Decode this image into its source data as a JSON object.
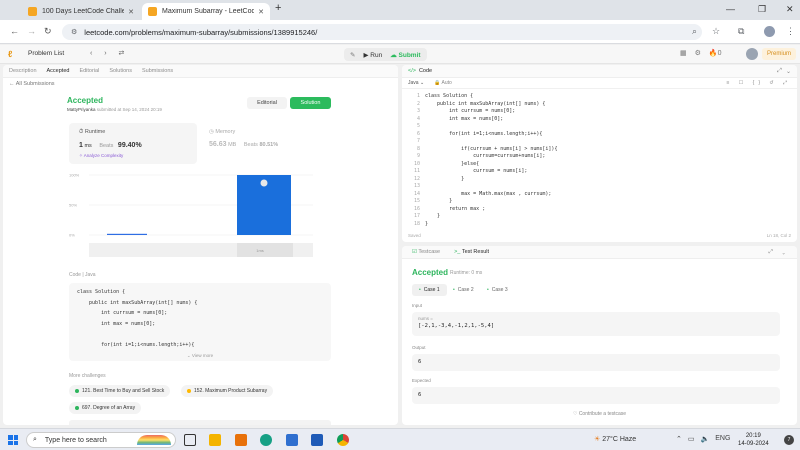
{
  "browser": {
    "tabs": [
      {
        "title": "100 Days LeetCode Challenge",
        "active": false
      },
      {
        "title": "Maximum Subarray - LeetCode",
        "active": true
      }
    ],
    "url": "leetcode.com/problems/maximum-subarray/submissions/1389915246/"
  },
  "lcnav": {
    "problem_list": "Problem List",
    "run": "Run",
    "submit": "Submit",
    "streak": "0",
    "premium": "Premium"
  },
  "left": {
    "tabs": [
      "Description",
      "Accepted",
      "Editorial",
      "Solutions",
      "Submissions"
    ],
    "back": "All Submissions",
    "status": "Accepted",
    "user": "MattyPriyanka",
    "submitted": "submitted at Sep 14, 2024 20:19",
    "editorial_btn": "Editorial",
    "solution_btn": "Solution",
    "runtime_label": "Runtime",
    "runtime_value": "1",
    "runtime_unit": "ms",
    "runtime_beats_label": "Beats",
    "runtime_beats": "99.40%",
    "analyze": "Analyze Complexity",
    "memory_label": "Memory",
    "memory_value": "56.63",
    "memory_unit": "MB",
    "memory_beats_label": "Beats",
    "memory_beats": "80.51%",
    "code_label": "Code",
    "code_lang": "Java",
    "code_lines": [
      "class Solution {",
      "    public int maxSubArray(int[] nums) {",
      "        int currsum = nums[0];",
      "        int max = nums[0];",
      "",
      "        for(int i=1;i<nums.length;i++){",
      "",
      "            if(currsum + nums[i] > nums[i]){"
    ],
    "view_more": "View more",
    "more_label": "More challenges",
    "challenges": [
      {
        "label": "121. Best Time to Buy and Sell Stock",
        "color": "#2db55d"
      },
      {
        "label": "152. Maximum Product Subarray",
        "color": "#ffb800"
      },
      {
        "label": "697. Degree of an Array",
        "color": "#2db55d"
      }
    ]
  },
  "chart_data": {
    "type": "bar",
    "categories": [
      "",
      "",
      "1ms"
    ],
    "values": [
      2,
      0,
      100
    ],
    "ylim": [
      0,
      100
    ],
    "yticks": [
      "100%",
      "50%",
      "0%"
    ],
    "colors": [
      "#2f6ee4",
      "#2f6ee4",
      "#1a6fdc"
    ],
    "grid": true
  },
  "editor": {
    "title": "Code",
    "lang": "Java",
    "auto": "Auto",
    "lines": [
      "class Solution {",
      "    public int maxSubArray(int[] nums) {",
      "        int currsum = nums[0];",
      "        int max = nums[0];",
      "",
      "        for(int i=1;i<nums.length;i++){",
      "",
      "            if(currsum + nums[i] > nums[i]){",
      "                currsum=currsum+nums[i];",
      "            }else{",
      "                currsum = nums[i];",
      "            }",
      "",
      "            max = Math.max(max , currsum);",
      "        }",
      "        return max ;",
      "    }",
      "}"
    ],
    "status": "Saved",
    "position": "Ln 18, Col 2"
  },
  "testpanel": {
    "tabs": [
      "Testcase",
      "Test Result"
    ],
    "status": "Accepted",
    "runtime": "Runtime: 0 ms",
    "cases": [
      "Case 1",
      "Case 2",
      "Case 3"
    ],
    "input_label": "Input",
    "input_name": "nums =",
    "input_value": "[-2,1,-3,4,-1,2,1,-5,4]",
    "output_label": "Output",
    "output_value": "6",
    "expected_label": "Expected",
    "expected_value": "6",
    "contribute": "Contribute a testcase"
  },
  "taskbar": {
    "search": "Type here to search",
    "weather": "27°C  Haze",
    "lang": "ENG",
    "time": "20:19",
    "date": "14-09-2024",
    "notifications": "7"
  }
}
